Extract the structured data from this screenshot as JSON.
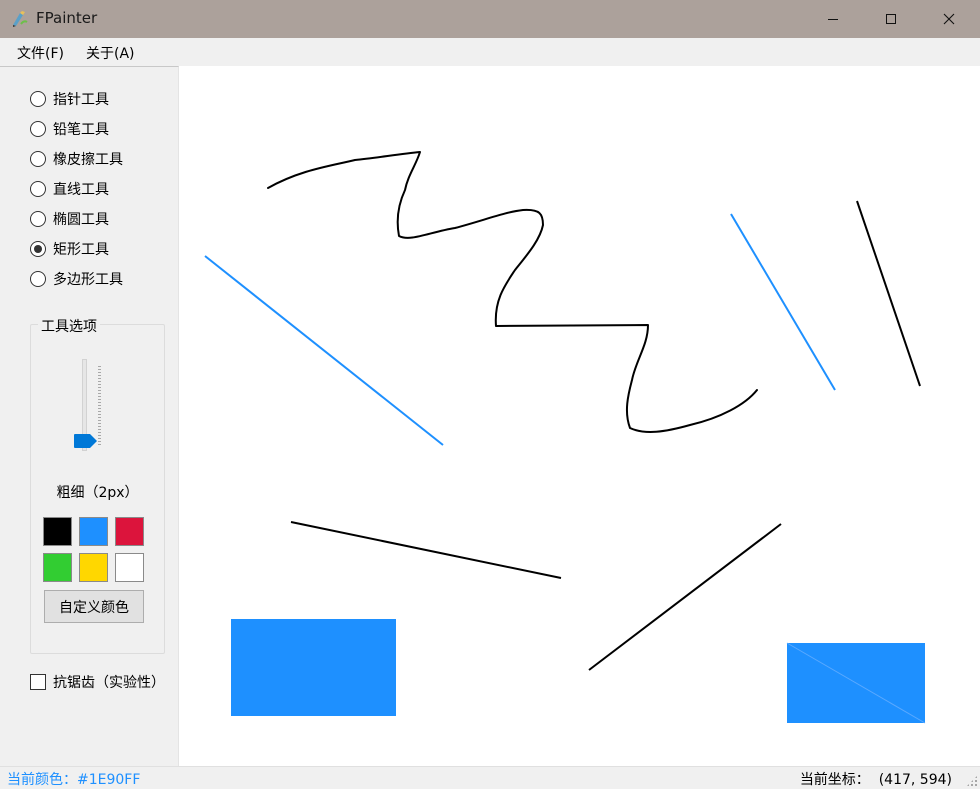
{
  "window": {
    "title": "FPainter",
    "icon": "fpainter-app-icon",
    "controls": [
      "minimize-icon",
      "maximize-icon",
      "close-icon"
    ]
  },
  "menu": {
    "file": "文件(F)",
    "about": "关于(A)"
  },
  "tools": {
    "items": [
      {
        "label": "指针工具",
        "selected": false
      },
      {
        "label": "铅笔工具",
        "selected": false
      },
      {
        "label": "橡皮擦工具",
        "selected": false
      },
      {
        "label": "直线工具",
        "selected": false
      },
      {
        "label": "椭圆工具",
        "selected": false
      },
      {
        "label": "矩形工具",
        "selected": true
      },
      {
        "label": "多边形工具",
        "selected": false
      }
    ]
  },
  "tool_options": {
    "title": "工具选项",
    "thickness_label": "粗细（2px）",
    "thickness_slider_fraction": 0.0,
    "palette": [
      "#000000",
      "#1E90FF",
      "#DC143C",
      "#32CD32",
      "#FFD700",
      "#FFFFFF"
    ],
    "custom_color_button": "自定义颜色"
  },
  "antialias": {
    "label": "抗锯齿（实验性）",
    "checked": false
  },
  "status": {
    "current_color": "当前颜色：#1E90FF",
    "current_coord_label": "当前坐标：",
    "current_coord_value": "(417, 594)"
  },
  "colors": {
    "accent": "#1E90FF",
    "titlebar": "#ACA19B",
    "stroke_black": "#000000"
  }
}
